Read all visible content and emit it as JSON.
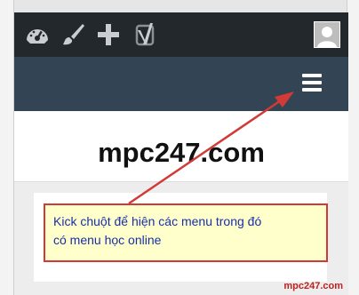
{
  "admin_bar": {
    "icons": [
      "dashboard-icon",
      "customize-brush-icon",
      "plus-icon",
      "yoast-seo-icon"
    ],
    "avatar": "user-avatar"
  },
  "header": {
    "menu_icon": "hamburger-menu-icon"
  },
  "site": {
    "title": "mpc247.com"
  },
  "annotation": {
    "line1": "Kick chuột để hiện các menu trong đó",
    "line2": "có menu học online"
  },
  "watermark": "mpc247.com",
  "colors": {
    "admin_bar": "#23282d",
    "header": "#334455",
    "annotation_border": "#d13a36",
    "annotation_text": "#1a2fa6"
  }
}
